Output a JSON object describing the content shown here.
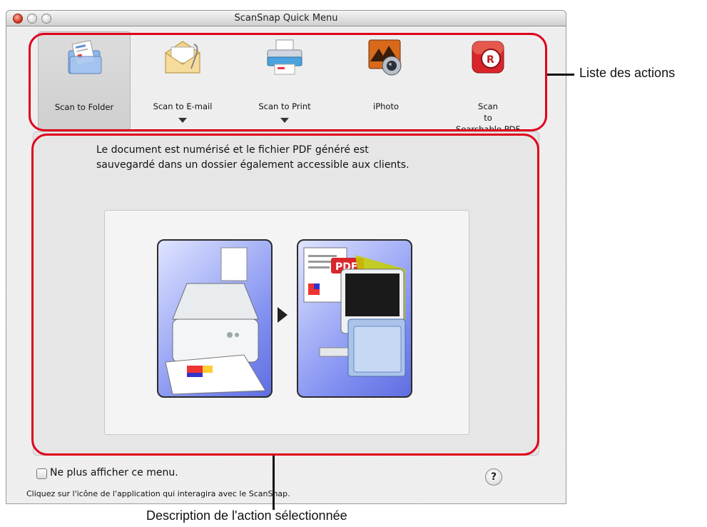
{
  "window": {
    "title": "ScanSnap Quick Menu"
  },
  "actions": [
    {
      "label": "Scan to Folder",
      "icon": "folder-scan-icon",
      "selected": true,
      "has_menu": false
    },
    {
      "label": "Scan to E-mail",
      "icon": "email-envelope-icon",
      "selected": false,
      "has_menu": true
    },
    {
      "label": "Scan to Print",
      "icon": "printer-icon",
      "selected": false,
      "has_menu": true
    },
    {
      "label": "iPhoto",
      "icon": "iphoto-camera-icon",
      "selected": false,
      "has_menu": false
    },
    {
      "label_lines": [
        "Scan",
        "to",
        "Searchable PDF"
      ],
      "icon": "searchable-pdf-icon",
      "selected": false,
      "has_menu": false
    }
  ],
  "description": {
    "line1": "Le document est numérisé et le fichier PDF généré est",
    "line2": "sauvegardé dans un dossier également accessible aux clients."
  },
  "illustration": {
    "pdf_badge": "PDF"
  },
  "footer": {
    "checkbox_label": "Ne plus afficher ce menu.",
    "checkbox_checked": false,
    "help_symbol": "?",
    "hint": "Cliquez sur l'icône de l'application qui interagira avec le ScanSnap."
  },
  "annotations": {
    "action_list": "Liste des actions",
    "selected_description": "Description de l'action sélectionnée"
  },
  "colors": {
    "highlight_red": "#e0001a",
    "window_bg": "#ececec"
  }
}
